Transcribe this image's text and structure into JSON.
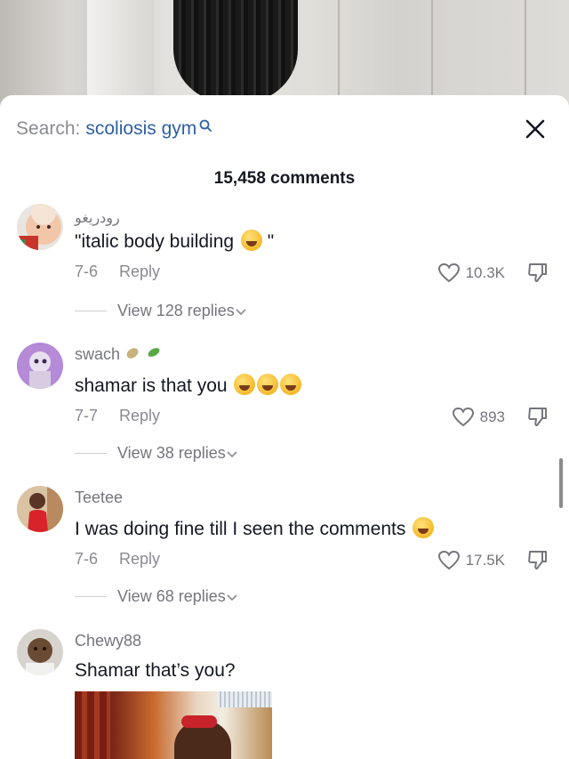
{
  "search": {
    "label": "Search:",
    "term": "scoliosis gym"
  },
  "comments_count": "15,458 comments",
  "comments": [
    {
      "username": "رودريغو",
      "text": "\"italic body building",
      "text_suffix": " \"",
      "date": "7-6",
      "reply_label": "Reply",
      "likes": "10.3K",
      "view_replies": "View 128 replies"
    },
    {
      "username": "swach",
      "text": "shamar is that you",
      "date": "7-7",
      "reply_label": "Reply",
      "likes": "893",
      "view_replies": "View 38 replies"
    },
    {
      "username": "Teetee",
      "text": "I was doing fine till I seen the comments",
      "date": "7-6",
      "reply_label": "Reply",
      "likes": "17.5K",
      "view_replies": "View 68 replies"
    },
    {
      "username": "Chewy88",
      "text": "Shamar that’s you?"
    }
  ],
  "colors": {
    "accent_search": "#2f5fa3",
    "text_primary": "#161823",
    "text_secondary": "#8a8b91"
  },
  "icons": [
    "search-icon",
    "close-icon",
    "heart-icon",
    "dislike-icon",
    "chevron-down-icon",
    "crying-emoji-icon",
    "laughing-emoji-icon"
  ]
}
